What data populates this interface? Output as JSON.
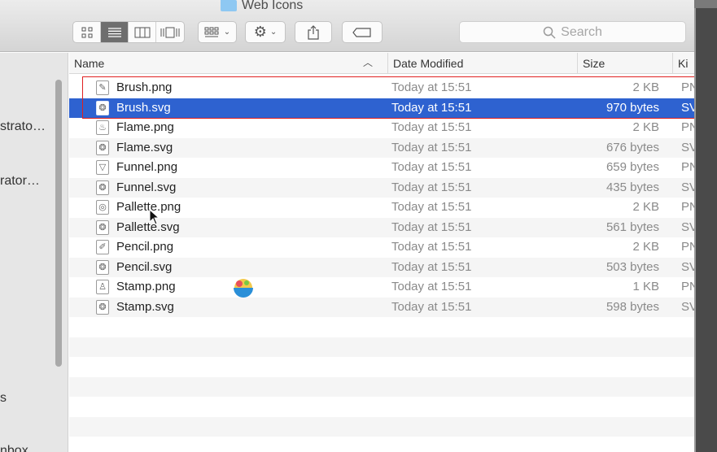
{
  "window": {
    "title": "Web Icons"
  },
  "toolbar": {
    "view_buttons": [
      "icon-view-icon",
      "list-view-icon",
      "column-view-icon",
      "cover-flow-icon"
    ],
    "active_view": 1,
    "arrange_icon": "arrange-grid-icon",
    "action_icon": "gear-icon",
    "share_icon": "share-icon",
    "tag_icon": "tag-icon"
  },
  "search": {
    "placeholder": "Search"
  },
  "sidebar": {
    "items": [
      "strato…",
      "rator…",
      "s",
      "nbox"
    ]
  },
  "columns": {
    "name": "Name",
    "date": "Date Modified",
    "size": "Size",
    "kind": "Ki"
  },
  "files": [
    {
      "name": "Brush.png",
      "date": "Today at 15:51",
      "size": "2 KB",
      "kind": "PN",
      "icon": "brush-icon",
      "glyph": "✎"
    },
    {
      "name": "Brush.svg",
      "date": "Today at 15:51",
      "size": "970 bytes",
      "kind": "SV",
      "icon": "svg-file-icon",
      "glyph": "❂",
      "selected": true
    },
    {
      "name": "Flame.png",
      "date": "Today at 15:51",
      "size": "2 KB",
      "kind": "PN",
      "icon": "flame-icon",
      "glyph": "♨"
    },
    {
      "name": "Flame.svg",
      "date": "Today at 15:51",
      "size": "676 bytes",
      "kind": "SV",
      "icon": "svg-file-icon",
      "glyph": "❂"
    },
    {
      "name": "Funnel.png",
      "date": "Today at 15:51",
      "size": "659 bytes",
      "kind": "PN",
      "icon": "funnel-icon",
      "glyph": "▽"
    },
    {
      "name": "Funnel.svg",
      "date": "Today at 15:51",
      "size": "435 bytes",
      "kind": "SV",
      "icon": "svg-file-icon",
      "glyph": "❂"
    },
    {
      "name": "Pallette.png",
      "date": "Today at 15:51",
      "size": "2 KB",
      "kind": "PN",
      "icon": "palette-icon",
      "glyph": "◎"
    },
    {
      "name": "Pallette.svg",
      "date": "Today at 15:51",
      "size": "561 bytes",
      "kind": "SV",
      "icon": "svg-file-icon",
      "glyph": "❂"
    },
    {
      "name": "Pencil.png",
      "date": "Today at 15:51",
      "size": "2 KB",
      "kind": "PN",
      "icon": "pencil-icon",
      "glyph": "✐"
    },
    {
      "name": "Pencil.svg",
      "date": "Today at 15:51",
      "size": "503 bytes",
      "kind": "SV",
      "icon": "svg-file-icon",
      "glyph": "❂"
    },
    {
      "name": "Stamp.png",
      "date": "Today at 15:51",
      "size": "1 KB",
      "kind": "PN",
      "icon": "stamp-icon",
      "glyph": "♙"
    },
    {
      "name": "Stamp.svg",
      "date": "Today at 15:51",
      "size": "598 bytes",
      "kind": "SV",
      "icon": "svg-file-icon",
      "glyph": "❂"
    }
  ],
  "colors": {
    "selection": "#2e62d0",
    "highlight_box": "#e02020",
    "folder": "#8ec8f2"
  }
}
